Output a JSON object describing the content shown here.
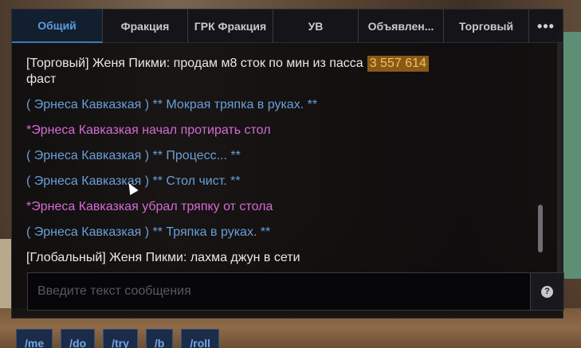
{
  "tabs": [
    {
      "label": "Общий"
    },
    {
      "label": "Фракция"
    },
    {
      "label": "ГРК Фракция"
    },
    {
      "label": "УВ"
    },
    {
      "label": "Объявлен..."
    },
    {
      "label": "Торговый"
    }
  ],
  "more_icon": "•••",
  "messages": [
    {
      "text": "[Торговый] Женя Пикми: продам м8 сток по мин из пасса",
      "price": "3 557 614",
      "text2": "фаст",
      "color": "#e8e8e8"
    },
    {
      "text": "( Эрнеса Кавказкая ) ** Мокрая тряпка в руках. **",
      "color": "#6a9fd8"
    },
    {
      "text": "*Эрнеса Кавказкая начал протирать стол",
      "color": "#d46ad6"
    },
    {
      "text": "( Эрнеса Кавказкая ) ** Процесс... **",
      "color": "#6a9fd8"
    },
    {
      "text": "( Эрнеса Кавказкая ) ** Стол чист. **",
      "color": "#6a9fd8"
    },
    {
      "text": "*Эрнеса Кавказкая убрал тряпку от стола",
      "color": "#d46ad6"
    },
    {
      "text": "( Эрнеса Кавказкая ) ** Тряпка в руках. **",
      "color": "#6a9fd8"
    },
    {
      "text": "[Глобальный] Женя Пикми: лахма джун в сети",
      "color": "#e8e8e8"
    }
  ],
  "input": {
    "placeholder": "Введите текст сообщения",
    "value": ""
  },
  "help_icon": "?",
  "commands": [
    "/me",
    "/do",
    "/try",
    "/b",
    "/roll"
  ]
}
